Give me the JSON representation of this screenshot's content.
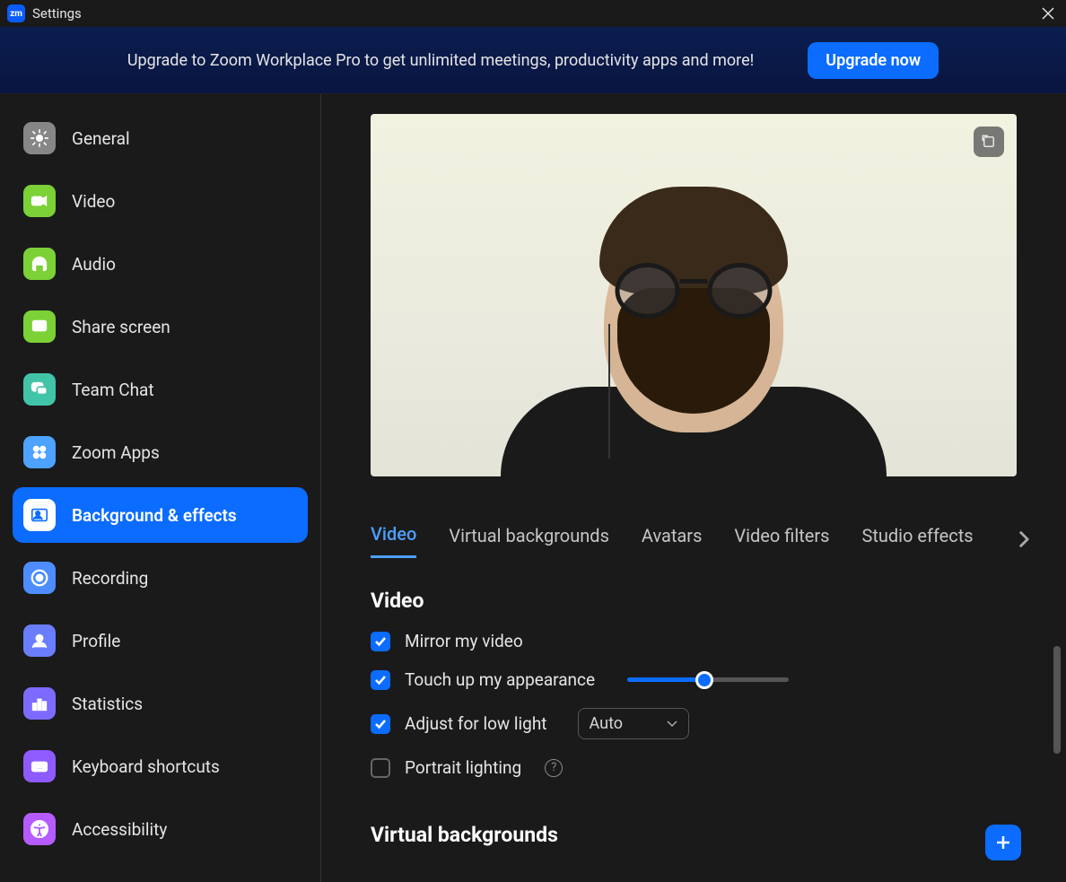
{
  "titlebar": {
    "title": "Settings"
  },
  "banner": {
    "text": "Upgrade to Zoom Workplace Pro to get unlimited meetings, productivity apps and more!",
    "button": "Upgrade now"
  },
  "sidebar": {
    "items": [
      {
        "label": "General",
        "icon": "gear",
        "bg": "#878787"
      },
      {
        "label": "Video",
        "icon": "video",
        "bg": "#7bd135"
      },
      {
        "label": "Audio",
        "icon": "headphones",
        "bg": "#7bd135"
      },
      {
        "label": "Share screen",
        "icon": "share",
        "bg": "#7bd135"
      },
      {
        "label": "Team Chat",
        "icon": "chat",
        "bg": "#42c4a8"
      },
      {
        "label": "Zoom Apps",
        "icon": "apps",
        "bg": "#4da3ff"
      },
      {
        "label": "Background & effects",
        "icon": "person",
        "bg": "#0b6cff",
        "active": true
      },
      {
        "label": "Recording",
        "icon": "record",
        "bg": "#4d8dff"
      },
      {
        "label": "Profile",
        "icon": "profile",
        "bg": "#6b7dff"
      },
      {
        "label": "Statistics",
        "icon": "stats",
        "bg": "#7d6bff"
      },
      {
        "label": "Keyboard shortcuts",
        "icon": "keyboard",
        "bg": "#8d5bff"
      },
      {
        "label": "Accessibility",
        "icon": "accessibility",
        "bg": "#b55bff"
      }
    ]
  },
  "tabs": {
    "items": [
      "Video",
      "Virtual backgrounds",
      "Avatars",
      "Video filters",
      "Studio effects"
    ],
    "active": 0
  },
  "video_section": {
    "title": "Video",
    "mirror": {
      "label": "Mirror my video",
      "checked": true
    },
    "touchup": {
      "label": "Touch up my appearance",
      "checked": true,
      "slider": 48
    },
    "lowlight": {
      "label": "Adjust for low light",
      "checked": true,
      "select_value": "Auto"
    },
    "portrait": {
      "label": "Portrait lighting",
      "checked": false,
      "help": true
    }
  },
  "virtual_backgrounds": {
    "title": "Virtual backgrounds"
  }
}
